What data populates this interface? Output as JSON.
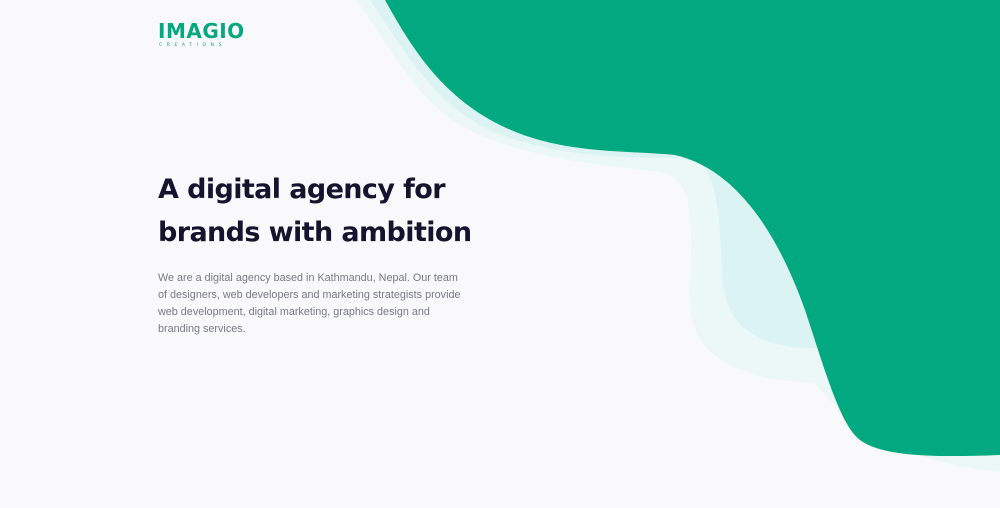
{
  "brand": {
    "name": "IMAGIO",
    "tagline": "CREATIONS"
  },
  "hero": {
    "headline_line1": "A digital agency for",
    "headline_line2": "brands with ambition",
    "description": "We are a digital agency based in Kathmandu, Nepal. Our team of designers, web developers and marketing strategists provide web development, digital marketing, graphics design and branding services."
  },
  "colors": {
    "accent": "#02a87f",
    "accent_light": "#dcf3f3",
    "accent_lighter": "#ecf8f8",
    "heading": "#15132e",
    "body_text": "#777a82",
    "background": "#f9f9fb"
  }
}
